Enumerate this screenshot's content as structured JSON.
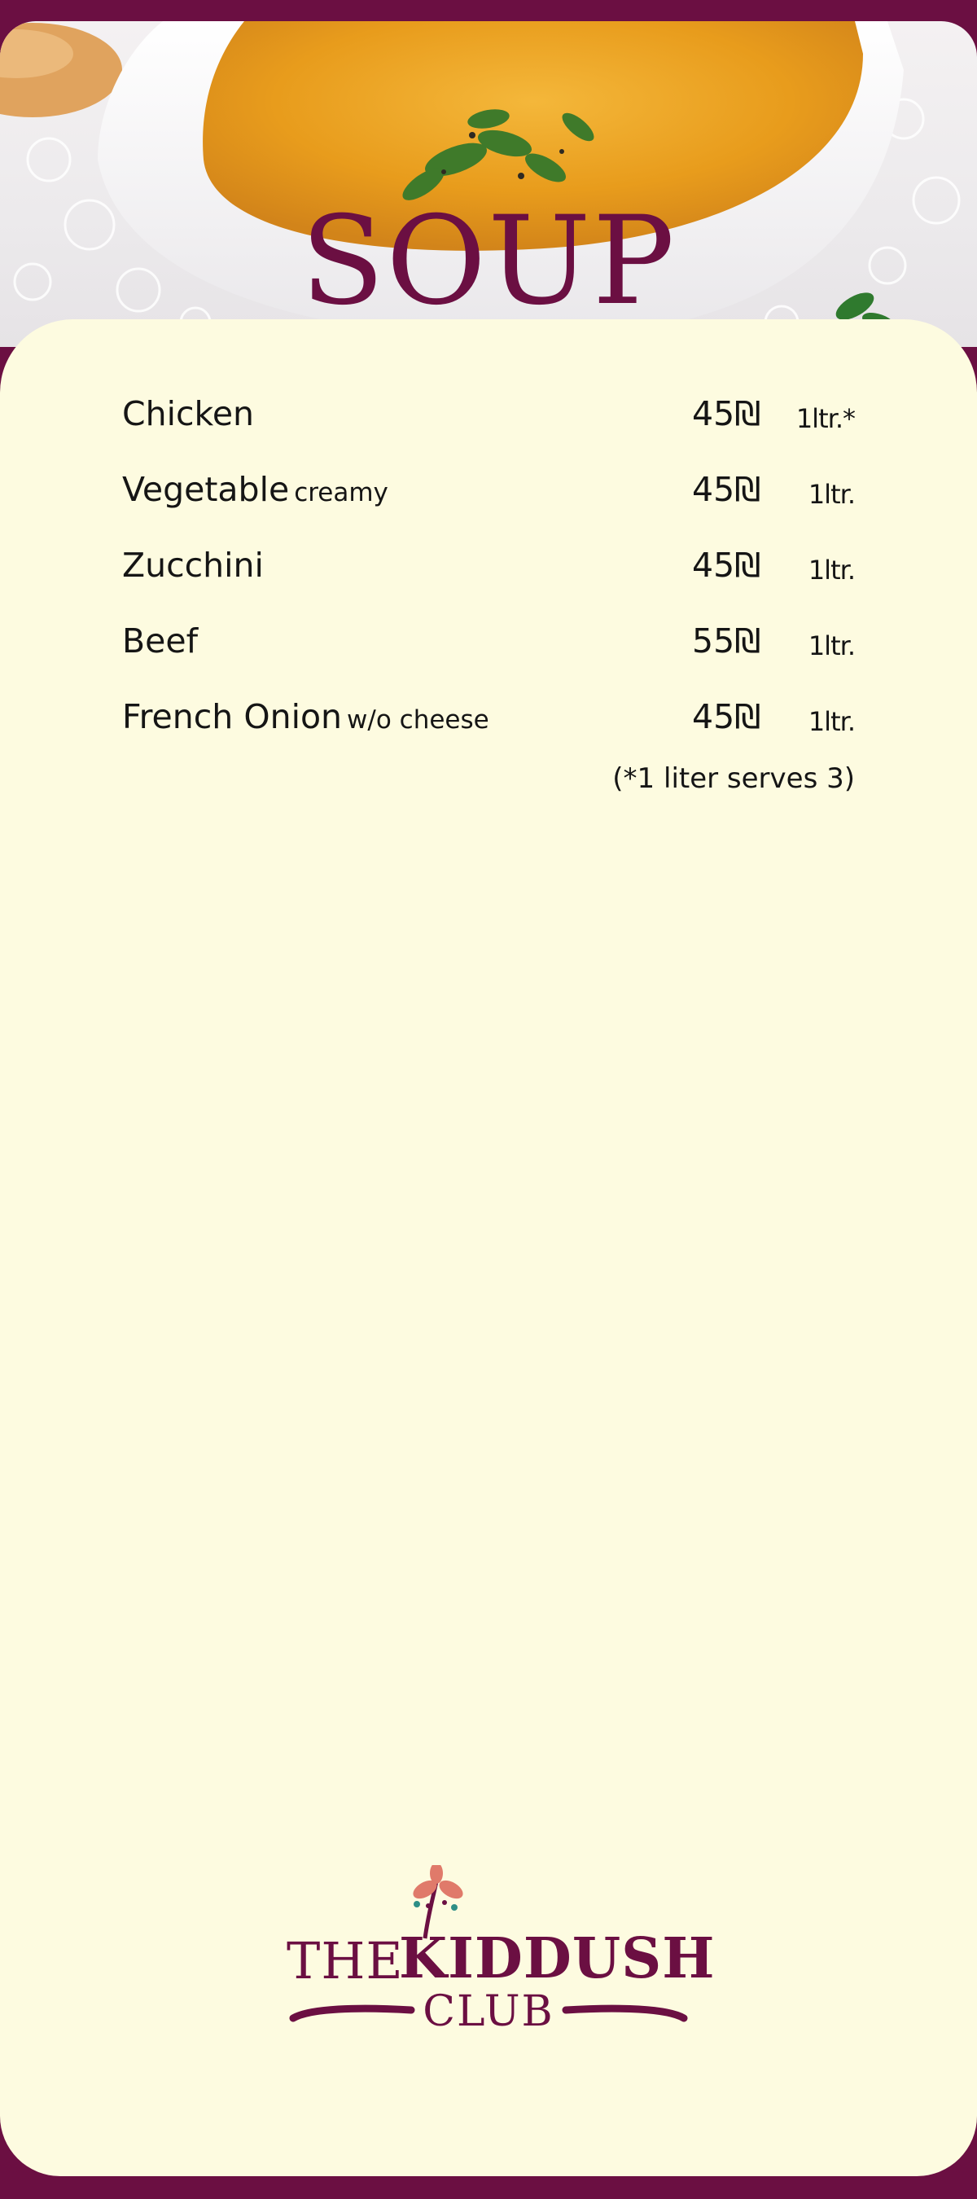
{
  "section_title": "SOUP",
  "menu_items": [
    {
      "name": "Chicken",
      "note": "",
      "price": "45₪",
      "quantity": "1ltr.*"
    },
    {
      "name": "Vegetable",
      "note": "creamy",
      "price": "45₪",
      "quantity": "1ltr."
    },
    {
      "name": "Zucchini",
      "note": "",
      "price": "45₪",
      "quantity": "1ltr."
    },
    {
      "name": "Beef",
      "note": "",
      "price": "55₪",
      "quantity": "1ltr."
    },
    {
      "name": "French Onion",
      "note": "w/o cheese",
      "price": "45₪",
      "quantity": "1ltr."
    }
  ],
  "footnote": "(*1 liter serves 3)",
  "logo": {
    "the": "THE",
    "kiddush": "KIDDUSH",
    "club": "CLUB"
  },
  "colors": {
    "brand": "#6b0f42",
    "card": "#fdfbe0",
    "text": "#151515",
    "soup": "#e6a21e"
  },
  "hero_image": "bowl-of-soup-photo"
}
